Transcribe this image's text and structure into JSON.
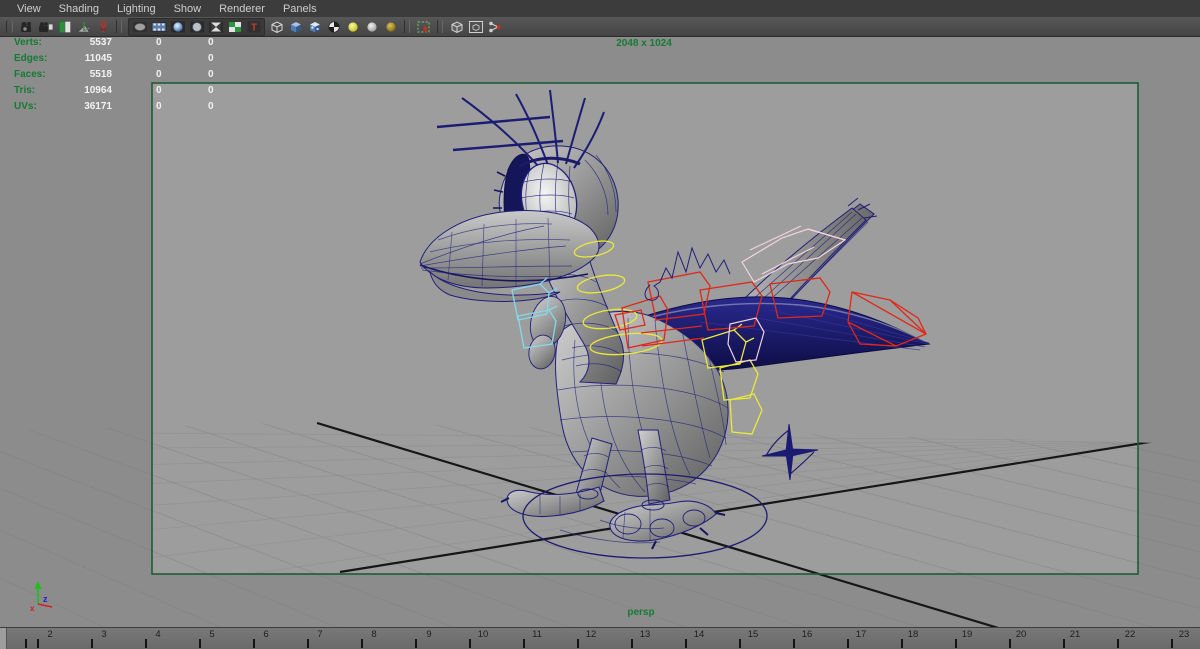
{
  "menu_bar": {
    "items": [
      "View",
      "Shading",
      "Lighting",
      "Show",
      "Renderer",
      "Panels"
    ]
  },
  "toolbar": {
    "icons": [
      "camera",
      "camera-settings",
      "bookmark",
      "image-plane",
      "pan-zoom",
      "gate-mask",
      "filmstrip",
      "lit-sphere",
      "flat-sphere",
      "checker-sphere",
      "shadow-checker",
      "texture-t",
      "cube-wireframe",
      "cube-shaded",
      "cube-textured",
      "checker-ball",
      "light-bright",
      "light-neutral",
      "light-dim",
      "isolate-select",
      "xray-cube",
      "framed-cube",
      "hypergraph"
    ]
  },
  "hud": {
    "rows": [
      {
        "label": "Verts:",
        "v1": "5537",
        "v2": "0",
        "v3": "0"
      },
      {
        "label": "Edges:",
        "v1": "11045",
        "v2": "0",
        "v3": "0"
      },
      {
        "label": "Faces:",
        "v1": "5518",
        "v2": "0",
        "v3": "0"
      },
      {
        "label": "Tris:",
        "v1": "10964",
        "v2": "0",
        "v3": "0"
      },
      {
        "label": "UVs:",
        "v1": "36171",
        "v2": "0",
        "v3": "0"
      }
    ]
  },
  "viewport": {
    "resolution_label": "2048 x 1024",
    "camera_label": "persp"
  },
  "timeline": {
    "frames": [
      "2",
      "3",
      "4",
      "5",
      "6",
      "7",
      "8",
      "9",
      "10",
      "11",
      "12",
      "13",
      "14",
      "15",
      "16",
      "17",
      "18",
      "19",
      "20",
      "21",
      "22",
      "23"
    ]
  },
  "colors": {
    "hud_green": "#157a36",
    "gate_green": "#1d5c33",
    "wireframe_navy": "#1e1e78",
    "control_red": "#e02818",
    "control_yellow": "#e9e93a",
    "control_cyan": "#84d9ec",
    "control_pink": "#f2d3de"
  }
}
